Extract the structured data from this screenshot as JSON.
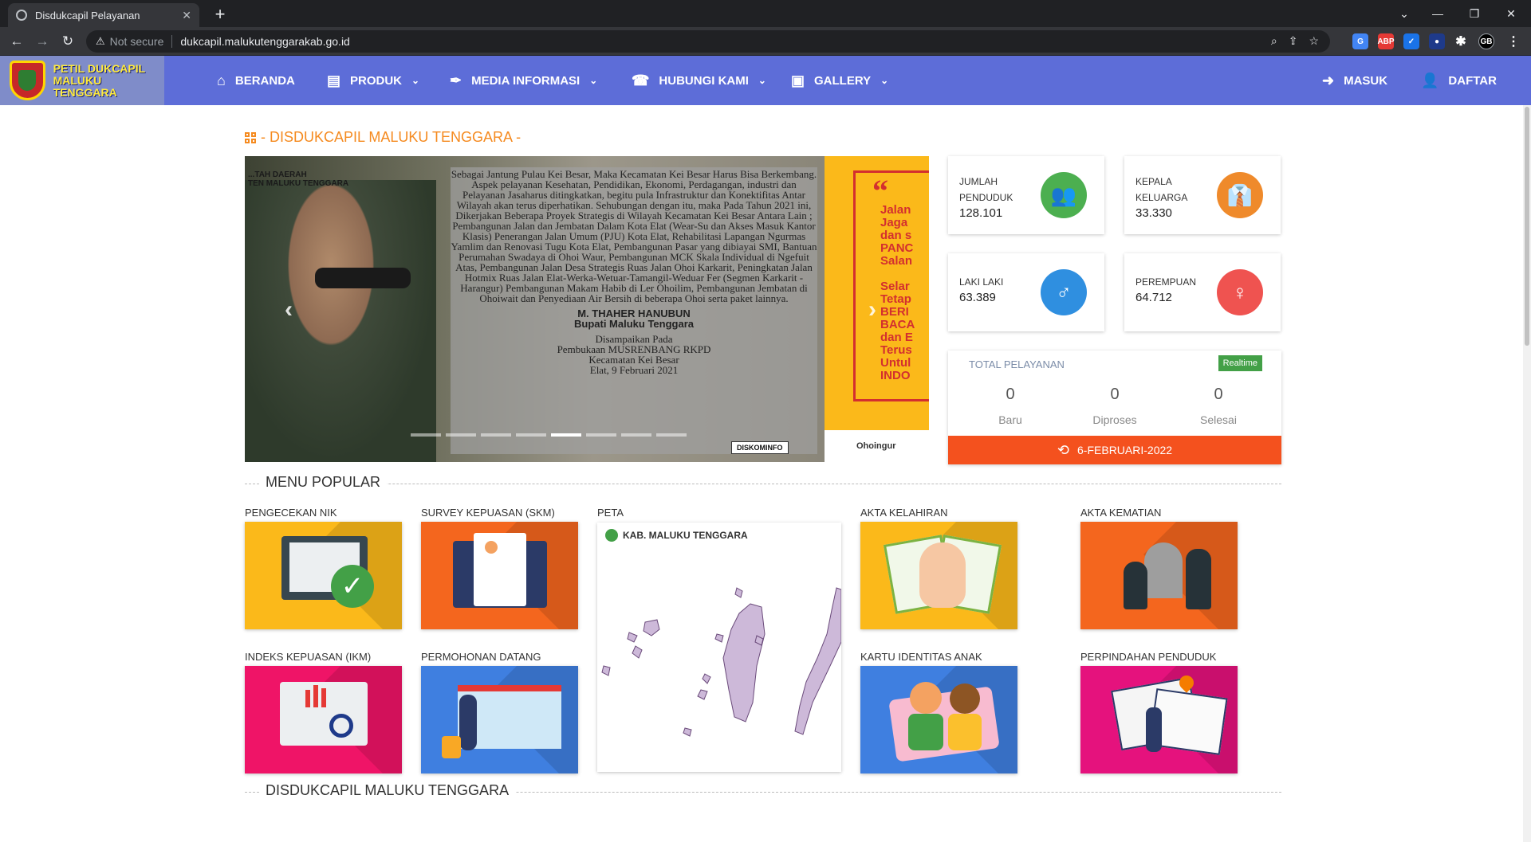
{
  "browser": {
    "tab_title": "Disdukcapil Pelayanan",
    "security_label": "Not secure",
    "url": "dukcapil.malukutenggarakab.go.id",
    "profile": "GB"
  },
  "site": {
    "brand_line1": "PETIL DUKCAPIL",
    "brand_line2": "MALUKU TENGGARA",
    "nav": {
      "beranda": "BERANDA",
      "produk": "PRODUK",
      "media": "MEDIA INFORMASI",
      "hubungi": "HUBUNGI KAMI",
      "gallery": "GALLERY",
      "masuk": "MASUK",
      "daftar": "DAFTAR"
    }
  },
  "hero": {
    "section_title": "- DISDUKCAPIL MALUKU TENGGARA -",
    "slide_banner": "...TAH DAERAH\nTEN MALUKU TENGGARA",
    "slide_text": "Sebagai Jantung Pulau Kei Besar, Maka Kecamatan Kei Besar Harus Bisa Berkembang. Aspek pelayanan Kesehatan, Pendidikan, Ekonomi, Perdagangan, industri dan Pelayanan Jasaharus ditingkatkan, begitu pula Infrastruktur dan Konektifitas Antar Wilayah akan terus diperhatikan. Sehubungan dengan itu, maka Pada Tahun 2021 ini, Dikerjakan Beberapa Proyek Strategis di Wilayah Kecamatan Kei Besar Antara Lain ; Pembangunan Jalan dan Jembatan Dalam Kota Elat (Wear-Su dan Akses Masuk Kantor Klasis) Penerangan Jalan Umum (PJU) Kota Elat, Rehabilitasi Lapangan Ngurmas Yamlim dan Renovasi Tugu Kota Elat, Pembangunan Pasar yang dibiayai SMI, Bantuan Perumahan Swadaya di Ohoi Waur, Pembangunan MCK Skala Individual di Ngefuit Atas, Pembangunan Jalan Desa Strategis Ruas Jalan Ohoi Karkarit, Peningkatan Jalan Hotmix Ruas Jalan Elat-Werka-Wetuar-Tamangil-Weduar Fer (Segmen Karkarit - Harangur) Pembangunan Makam Habib di Ler Ohoilim, Pembangunan Jembatan di Ohoiwait dan Penyediaan Air Bersih di beberapa Ohoi serta paket lainnya.",
    "slide_signer": "M. THAHER HANUBUN",
    "slide_signer_title": "Bupati Maluku Tenggara",
    "slide_footer1": "Disampaikan Pada",
    "slide_footer2": "Pembukaan MUSRENBANG RKPD",
    "slide_footer3": "Kecamatan Kei Besar",
    "slide_footer4": "Elat, 9 Februari 2021",
    "slide_logo": "DISKOMINFO",
    "slide2_lines": "Jalan\nJaga\ndan s\nPANC\nSalan\n\nSelar\nTetap\nBERI\nBACA\ndan E\nTerus\nUntul\nINDO",
    "slide2_footer": "Ohoingur"
  },
  "stats": {
    "penduduk_label": "JUMLAH PENDUDUK",
    "penduduk_value": "128.101",
    "keluarga_label": "KEPALA KELUARGA",
    "keluarga_value": "33.330",
    "laki_label": "LAKI LAKI",
    "laki_value": "63.389",
    "perempuan_label": "PEREMPUAN",
    "perempuan_value": "64.712"
  },
  "pelayanan": {
    "title": "TOTAL PELAYANAN",
    "badge": "Realtime",
    "baru_value": "0",
    "baru_label": "Baru",
    "diproses_value": "0",
    "diproses_label": "Diproses",
    "selesai_value": "0",
    "selesai_label": "Selesai",
    "date": "6-FEBRUARI-2022"
  },
  "menu_popular": {
    "heading": "MENU POPULAR",
    "items": {
      "nik": "PENGECEKAN NIK",
      "skm": "SURVEY KEPUASAN (SKM)",
      "peta": "PETA",
      "kelahiran": "AKTA KELAHIRAN",
      "kematian": "AKTA KEMATIAN",
      "ikm": "INDEKS KEPUASAN (IKM)",
      "datang": "PERMOHONAN DATANG",
      "kia": "KARTU IDENTITAS ANAK",
      "pindah": "PERPINDAHAN PENDUDUK"
    },
    "map_title": "KAB. MALUKU TENGGARA"
  },
  "footer_heading": "DISDUKCAPIL MALUKU TENGGARA",
  "colors": {
    "nav_bg": "#5d6dd8",
    "accent_orange": "#f58a1f",
    "green": "#4caf50",
    "orange": "#ef8a2b",
    "blue": "#2f8fe0",
    "red": "#ef5350",
    "map_fill": "#cdb9d9"
  },
  "icons": {
    "beranda": "home-icon",
    "produk": "newspaper-icon",
    "media": "feather-icon",
    "hubungi": "phone-icon",
    "gallery": "image-icon",
    "masuk": "sign-in-icon",
    "daftar": "user-plus-icon"
  }
}
